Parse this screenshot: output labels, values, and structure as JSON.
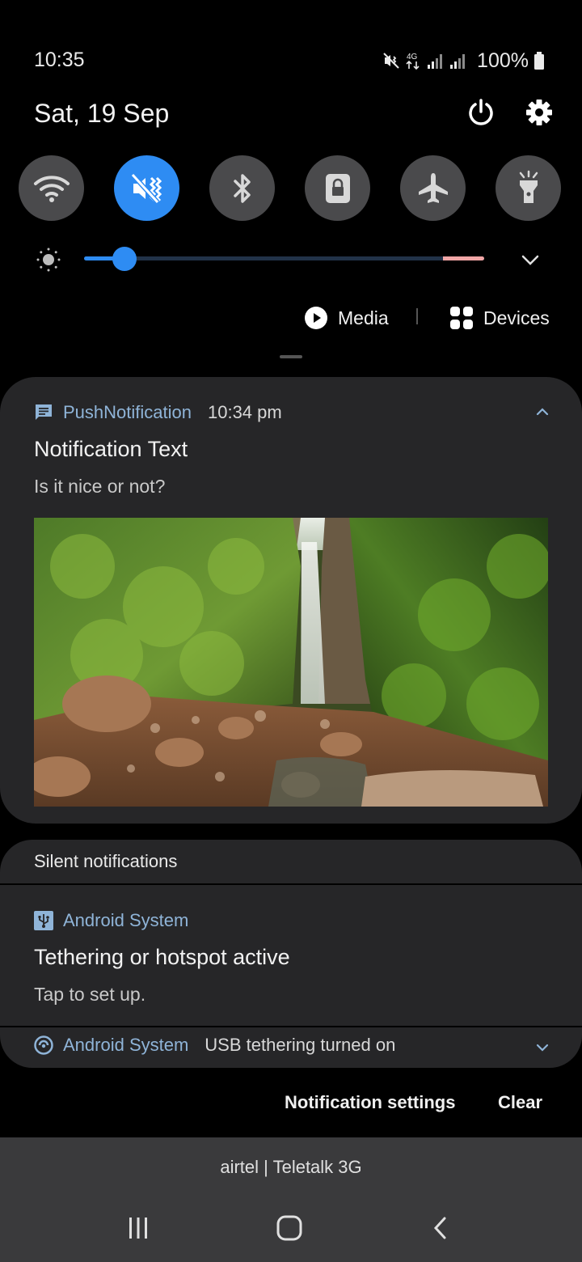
{
  "status_bar": {
    "time": "10:35",
    "network_label": "4G",
    "battery": "100%",
    "icons": [
      "mute-vibrate-icon",
      "4g-icon",
      "signal-icon",
      "signal-icon",
      "battery-icon"
    ]
  },
  "header": {
    "date": "Sat, 19 Sep",
    "power_icon": "power-icon",
    "settings_icon": "gear-icon"
  },
  "quick_toggles": [
    {
      "name": "wifi",
      "icon": "wifi-icon",
      "active": false
    },
    {
      "name": "sound",
      "icon": "vibrate-icon",
      "active": true
    },
    {
      "name": "bluetooth",
      "icon": "bluetooth-icon",
      "active": false
    },
    {
      "name": "rotation-lock",
      "icon": "lock-icon",
      "active": false
    },
    {
      "name": "airplane",
      "icon": "airplane-icon",
      "active": false
    },
    {
      "name": "flashlight",
      "icon": "flashlight-icon",
      "active": false
    }
  ],
  "brightness": {
    "level": 0.1
  },
  "controls": {
    "media_label": "Media",
    "devices_label": "Devices"
  },
  "push_notification": {
    "app_name": "PushNotification",
    "time": "10:34 pm",
    "title": "Notification Text",
    "body": "Is it nice or not?"
  },
  "silent": {
    "header": "Silent notifications",
    "items": [
      {
        "app_name": "Android System",
        "title": "Tethering or hotspot active",
        "body": "Tap to set up."
      },
      {
        "app_name": "Android System",
        "summary": "USB tethering turned on"
      }
    ]
  },
  "footer": {
    "settings_label": "Notification settings",
    "clear_label": "Clear"
  },
  "carrier": "airtel | Teletalk 3G",
  "colors": {
    "accent": "#2e8cf3",
    "app_name": "#8fb4d8",
    "card": "#262628"
  }
}
